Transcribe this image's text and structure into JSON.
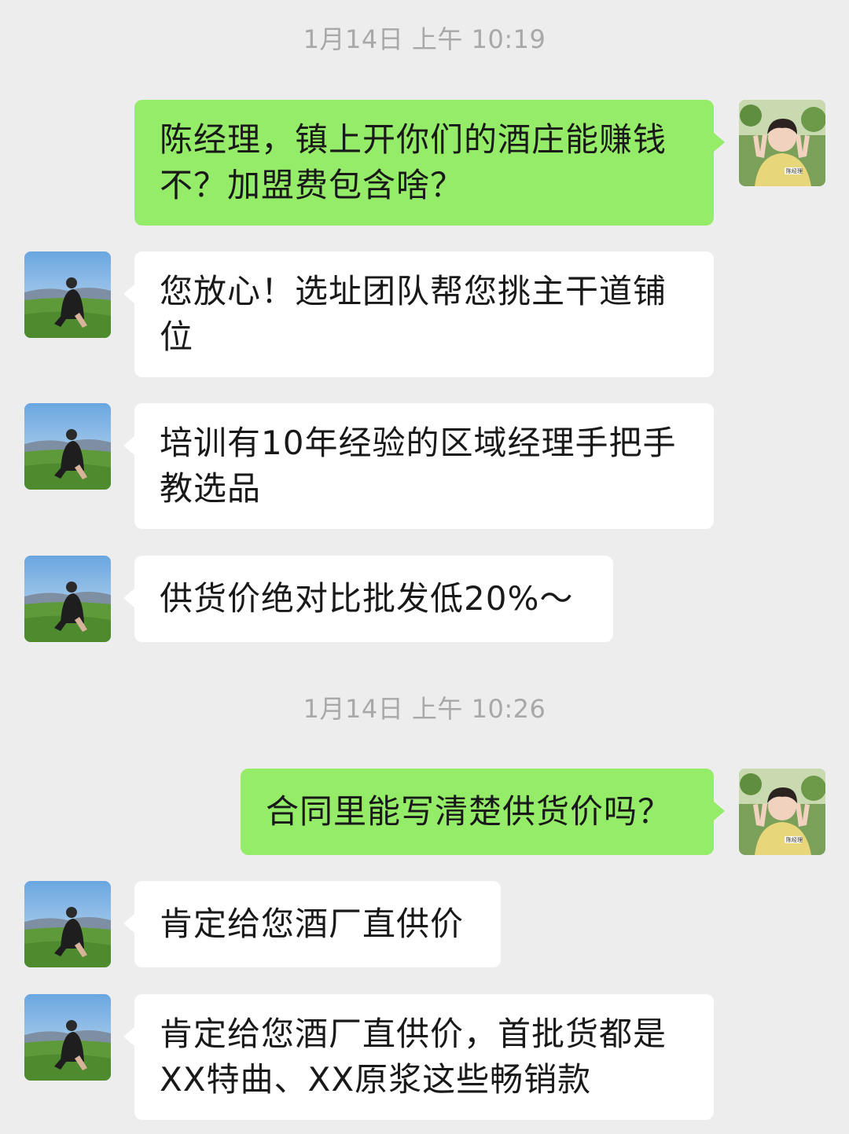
{
  "timestamps": [
    "1月14日 上午 10:19",
    "1月14日 上午 10:26"
  ],
  "avatars": {
    "self": "avatar-boy-peace-sign",
    "other": "avatar-man-sitting-on-hill",
    "self_badge_text": "陈经理"
  },
  "messages": [
    {
      "sender": "self",
      "text": "陈经理，镇上开你们的酒庄能赚钱不？加盟费包含啥？"
    },
    {
      "sender": "other",
      "text": "您放心！选址团队帮您挑主干道铺位"
    },
    {
      "sender": "other",
      "text": "培训有10年经验的区域经理手把手教选品"
    },
    {
      "sender": "other",
      "text": "供货价绝对比批发低20%～"
    },
    {
      "sender": "self",
      "text": "合同里能写清楚供货价吗？"
    },
    {
      "sender": "other",
      "text": "肯定给您酒厂直供价"
    },
    {
      "sender": "other",
      "text": "肯定给您酒厂直供价，首批货都是XX特曲、XX原浆这些畅销款"
    }
  ],
  "colors": {
    "background": "#ededed",
    "outgoing_bubble": "#95ec69",
    "incoming_bubble": "#ffffff",
    "timestamp_text": "#a8a8a8"
  }
}
